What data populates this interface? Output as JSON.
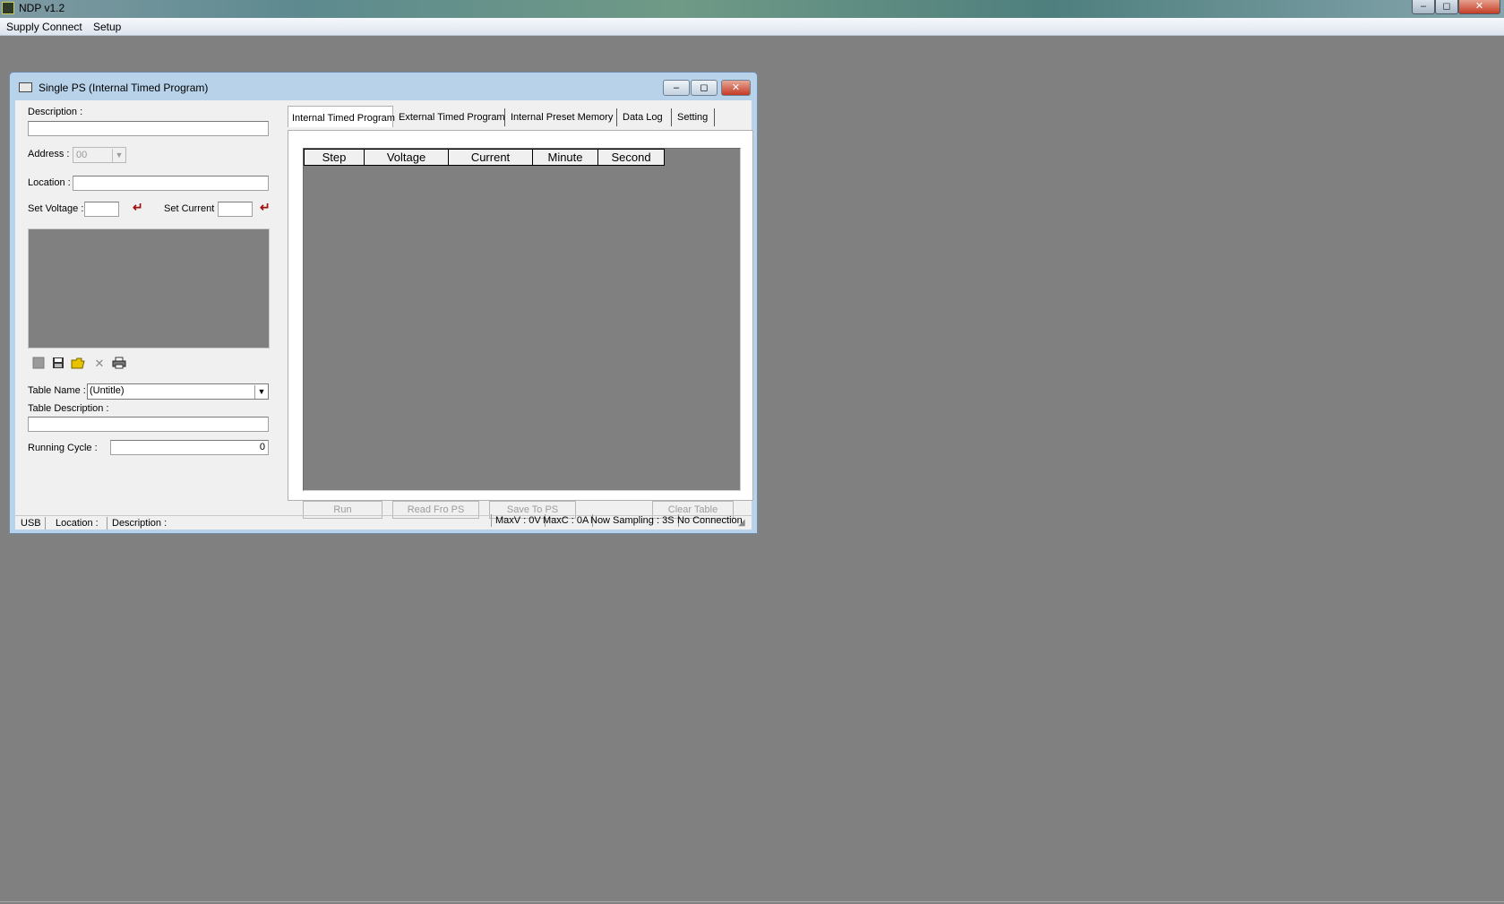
{
  "app": {
    "title": "NDP v1.2",
    "caption_min": "–",
    "caption_max": "◻",
    "caption_close": "✕"
  },
  "menu": [
    "Supply Connect",
    "Setup"
  ],
  "child": {
    "title": "Single PS (Internal Timed Program)",
    "caption_min": "–",
    "caption_max": "◻",
    "caption_close": "✕"
  },
  "left": {
    "description_label": "Description :",
    "description_value": "",
    "address_label": "Address :",
    "address_value": "00",
    "location_label": "Location :",
    "location_value": "",
    "set_voltage_label": "Set Voltage :",
    "set_voltage_value": "",
    "set_current_label": "Set Current :",
    "set_current_value": "",
    "enter_symbol": "↵",
    "toolbar_icons": [
      "new-icon",
      "save-icon",
      "open-folder-icon",
      "delete-icon",
      "print-icon"
    ],
    "table_name_label": "Table Name :",
    "table_name_value": "(Untitle)",
    "table_description_label": "Table Description :",
    "table_description_value": "",
    "running_cycle_label": "Running Cycle :",
    "running_cycle_value": "0"
  },
  "tabs": [
    "Internal Timed Program",
    "External Timed Program",
    "Internal Preset Memory",
    "Data Log",
    "Setting"
  ],
  "active_tab": 0,
  "grid": {
    "columns": [
      "Step",
      "Voltage",
      "Current",
      "Minute",
      "Second"
    ]
  },
  "buttons": {
    "run": "Run",
    "read": "Read Fro PS",
    "save": "Save To PS",
    "clear": "Clear Table"
  },
  "status_left": [
    "USB",
    "Location :",
    "Description :"
  ],
  "status_right": [
    "MaxV : 0V",
    "MaxC : 0A",
    "Now Sampling : 3S",
    "No Connection"
  ]
}
